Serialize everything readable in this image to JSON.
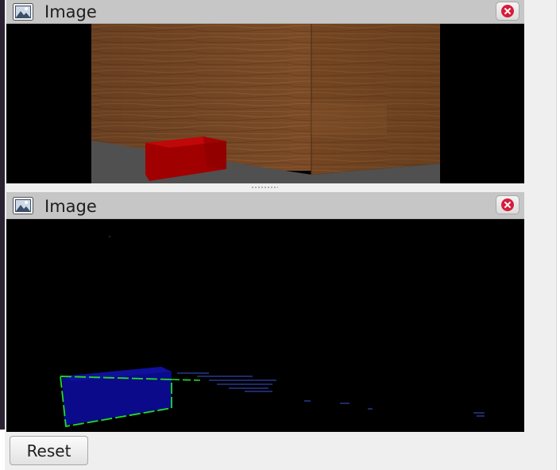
{
  "panels": [
    {
      "title": "Image",
      "icon": "image-icon",
      "close_icon": "close-icon"
    },
    {
      "title": "Image",
      "icon": "image-icon",
      "close_icon": "close-icon"
    }
  ],
  "controls": {
    "reset_label": "Reset"
  },
  "colors": {
    "titlebar": "#c6c6c6",
    "close_dot": "#d61c3a",
    "wood": "#7a4a26",
    "floor": "#505050",
    "red_box": "#a00000",
    "blue_box": "#0a0a8a",
    "green_outline": "#22dd22"
  }
}
